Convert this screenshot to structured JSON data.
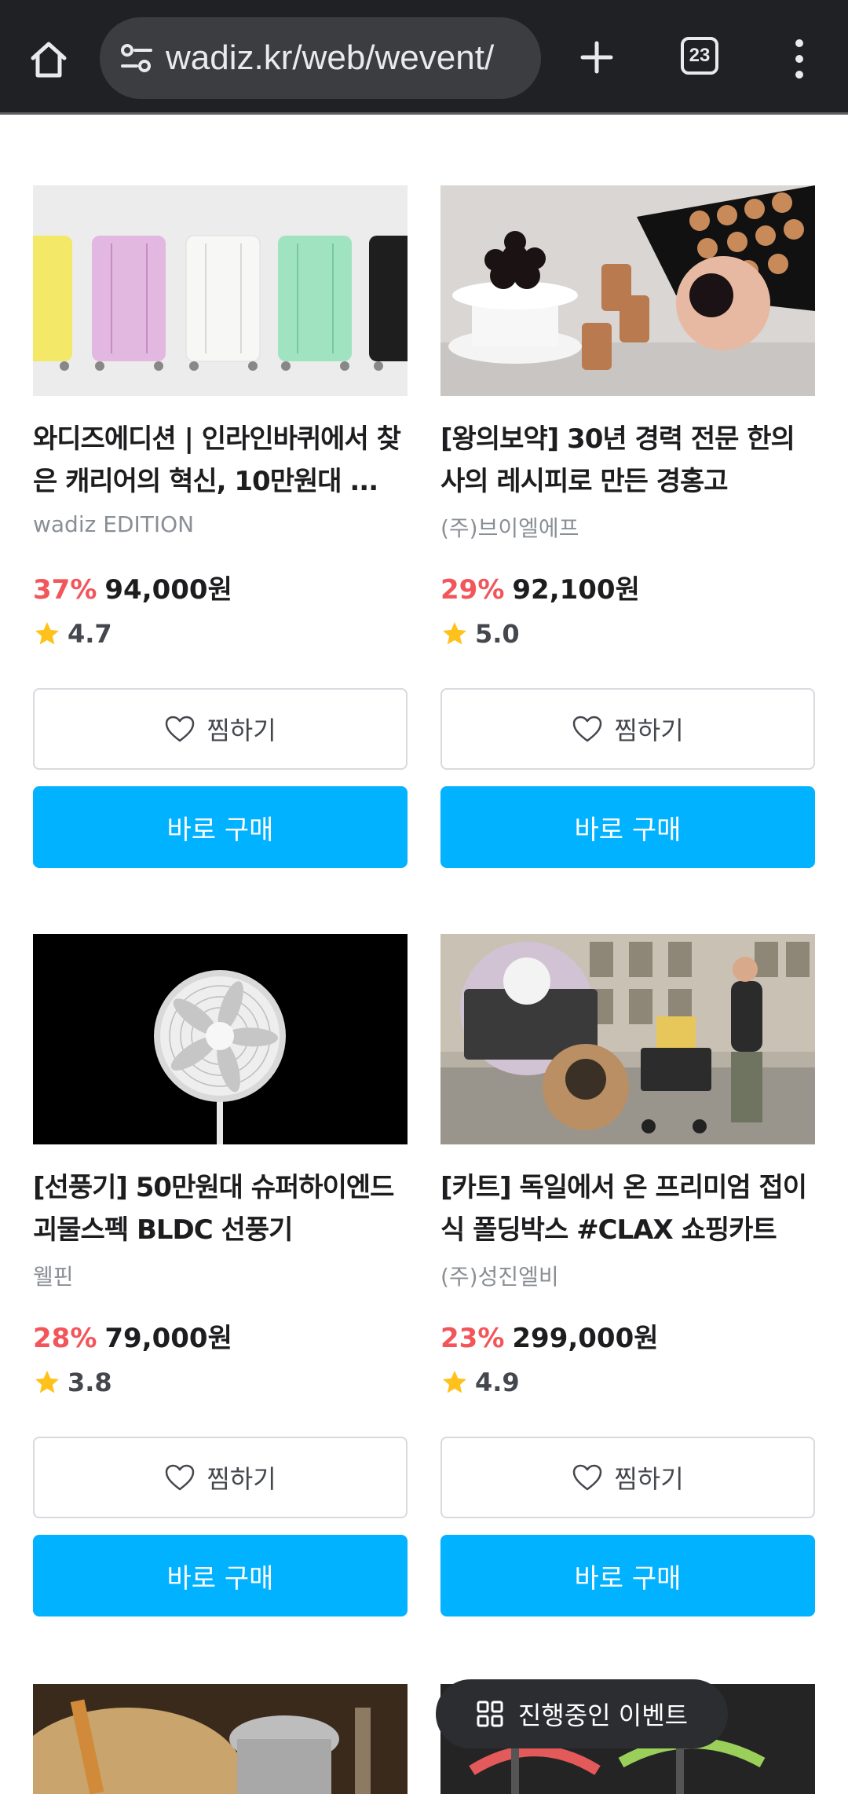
{
  "browser": {
    "url": "wadiz.kr/web/wevent/",
    "tab_count": "23"
  },
  "products": [
    {
      "title": "와디즈에디션 | 인라인바퀴에서 찾은 캐리어의 혁신, 10만원대 ...",
      "maker": "wadiz EDITION",
      "discount": "37%",
      "price": "94,000원",
      "rating": "4.7",
      "wish_label": "찜하기",
      "buy_label": "바로 구매"
    },
    {
      "title": "[왕의보약] 30년 경력 전문 한의사의 레시피로 만든 경홍고",
      "maker": "(주)브이엘에프",
      "discount": "29%",
      "price": "92,100원",
      "rating": "5.0",
      "wish_label": "찜하기",
      "buy_label": "바로 구매"
    },
    {
      "title": "[선풍기] 50만원대 슈퍼하이엔드 괴물스펙 BLDC 선풍기",
      "maker": "웰핀",
      "discount": "28%",
      "price": "79,000원",
      "rating": "3.8",
      "wish_label": "찜하기",
      "buy_label": "바로 구매"
    },
    {
      "title": "[카트] 독일에서 온 프리미엄 접이식 폴딩박스 #CLAX 쇼핑카트",
      "maker": "(주)성진엘비",
      "discount": "23%",
      "price": "299,000원",
      "rating": "4.9",
      "wish_label": "찜하기",
      "buy_label": "바로 구매"
    }
  ],
  "floating": {
    "event_label": "진행중인 이벤트"
  },
  "colors": {
    "accent": "#00b2ff",
    "discount": "#f2555a",
    "star": "#ffc21d",
    "toolbar": "#202124"
  },
  "icons": [
    "home-icon",
    "tune-icon",
    "plus-icon",
    "tab-switcher-icon",
    "more-vert-icon",
    "heart-icon",
    "star-icon",
    "grid-icon"
  ]
}
